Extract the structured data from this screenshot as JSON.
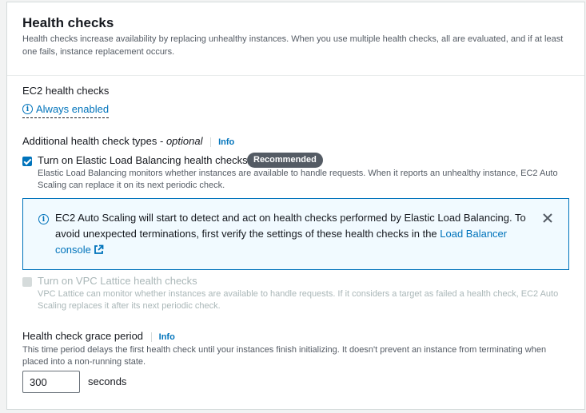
{
  "header": {
    "title": "Health checks",
    "description": "Health checks increase availability by replacing unhealthy instances. When you use multiple health checks, all are evaluated, and if at least one fails, instance replacement occurs."
  },
  "ec2": {
    "label": "EC2 health checks",
    "status": "Always enabled"
  },
  "additional": {
    "label": "Additional health check types - ",
    "label_optional": "optional",
    "info": "Info"
  },
  "elb": {
    "checked": true,
    "label": "Turn on Elastic Load Balancing health checks",
    "badge": "Recommended",
    "description": "Elastic Load Balancing monitors whether instances are available to handle requests. When it reports an unhealthy instance, EC2 Auto Scaling can replace it on its next periodic check."
  },
  "alert": {
    "text": "EC2 Auto Scaling will start to detect and act on health checks performed by Elastic Load Balancing. To avoid unexpected terminations, first verify the settings of these health checks in the ",
    "link": "Load Balancer console"
  },
  "vpc": {
    "checked": false,
    "disabled": true,
    "label": "Turn on VPC Lattice health checks",
    "description": "VPC Lattice can monitor whether instances are available to handle requests. If it considers a target as failed a health check, EC2 Auto Scaling replaces it after its next periodic check."
  },
  "grace": {
    "label": "Health check grace period",
    "info": "Info",
    "description": "This time period delays the first health check until your instances finish initializing. It doesn't prevent an instance from terminating when placed into a non-running state.",
    "value": "300",
    "unit": "seconds"
  },
  "colors": {
    "link": "#0073bb",
    "alert_bg": "#f1faff",
    "badge_bg": "#545b64"
  }
}
